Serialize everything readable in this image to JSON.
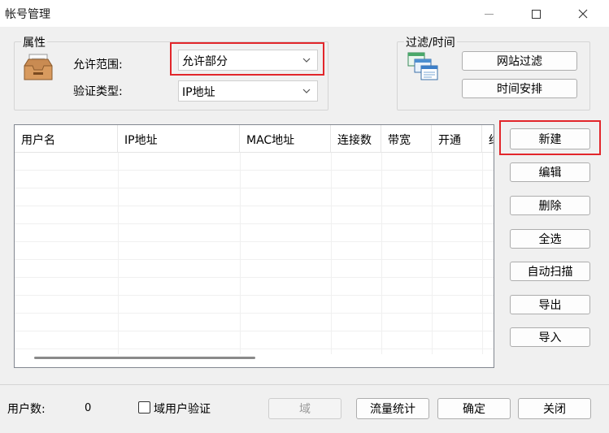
{
  "window": {
    "title": "帐号管理"
  },
  "attributes": {
    "group_title": "属性",
    "allow_scope_label": "允许范围:",
    "allow_scope_value": "允许部分",
    "auth_type_label": "验证类型:",
    "auth_type_value": "IP地址"
  },
  "filter": {
    "group_title": "过滤/时间",
    "website_filter_label": "网站过滤",
    "schedule_label": "时间安排"
  },
  "table": {
    "columns": [
      "用户名",
      "IP地址",
      "MAC地址",
      "连接数",
      "带宽",
      "开通",
      "结"
    ],
    "rows": []
  },
  "side_buttons": {
    "new_label": "新建",
    "edit_label": "编辑",
    "delete_label": "删除",
    "select_all_label": "全选",
    "auto_scan_label": "自动扫描",
    "export_label": "导出",
    "import_label": "导入"
  },
  "footer": {
    "user_count_label": "用户数:",
    "user_count_value": "0",
    "domain_auth_label": "域用户验证",
    "domain_label": "域",
    "traffic_stats_label": "流量统计",
    "ok_label": "确定",
    "close_label": "关闭"
  },
  "colors": {
    "highlight": "#e2262b"
  }
}
